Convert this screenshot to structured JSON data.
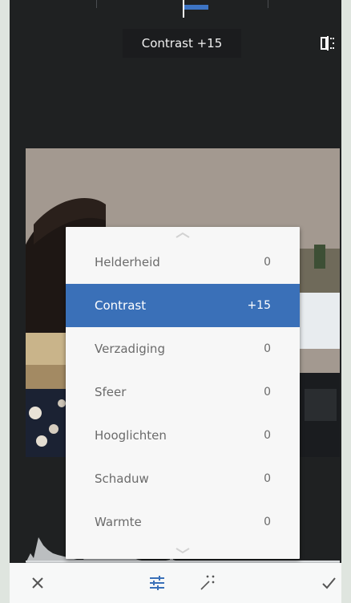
{
  "parameter_display": "Contrast +15",
  "menu": {
    "items": [
      {
        "label": "Helderheid",
        "value": "0"
      },
      {
        "label": "Contrast",
        "value": "+15"
      },
      {
        "label": "Verzadiging",
        "value": "0"
      },
      {
        "label": "Sfeer",
        "value": "0"
      },
      {
        "label": "Hooglichten",
        "value": "0"
      },
      {
        "label": "Schaduw",
        "value": "0"
      },
      {
        "label": "Warmte",
        "value": "0"
      }
    ],
    "selected_index": 1
  },
  "icons": {
    "compare": "compare-icon",
    "cancel": "close-icon",
    "adjust": "tune-sliders-icon",
    "auto": "magic-wand-icon",
    "apply": "checkmark-icon"
  },
  "colors": {
    "accent": "#3a70b8",
    "background": "#1f2122",
    "menu_bg": "#f7f7f7"
  }
}
